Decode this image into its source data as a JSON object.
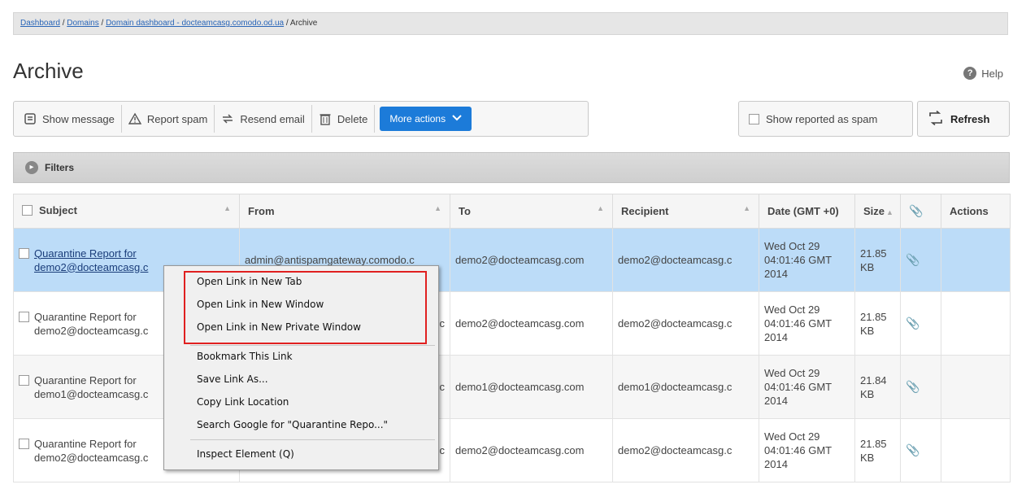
{
  "breadcrumb": {
    "items": [
      "Dashboard",
      "Domains",
      "Domain dashboard - docteamcasg.comodo.od.ua"
    ],
    "current": "Archive",
    "sep": " / "
  },
  "page": {
    "title": "Archive",
    "help_label": "Help"
  },
  "toolbar": {
    "show_message": "Show message",
    "report_spam": "Report spam",
    "resend_email": "Resend email",
    "delete": "Delete",
    "more_actions": "More actions",
    "show_reported_spam": "Show reported as spam",
    "refresh": "Refresh"
  },
  "filters": {
    "label": "Filters"
  },
  "table": {
    "headers": [
      "Subject",
      "From",
      "To",
      "Recipient",
      "Date (GMT +0)",
      "Size",
      "",
      "Actions"
    ],
    "rows": [
      {
        "subject_line1": "Quarantine Report for",
        "subject_line2": "demo2@docteamcasg.c",
        "from": "admin@antispamgateway.comodo.c",
        "to": "demo2@docteamcasg.com",
        "recipient": "demo2@docteamcasg.c",
        "date_line1": "Wed Oct 29",
        "date_line2": "04:01:46 GMT",
        "date_line3": "2014",
        "size_line1": "21.85",
        "size_line2": "KB"
      },
      {
        "subject_line1": "Quarantine Report for",
        "subject_line2": "demo2@docteamcasg.c",
        "from": ".c",
        "to": "demo2@docteamcasg.com",
        "recipient": "demo2@docteamcasg.c",
        "date_line1": "Wed Oct 29",
        "date_line2": "04:01:46 GMT",
        "date_line3": "2014",
        "size_line1": "21.85",
        "size_line2": "KB"
      },
      {
        "subject_line1": "Quarantine Report for",
        "subject_line2": "demo1@docteamcasg.c",
        "from": ".c",
        "to": "demo1@docteamcasg.com",
        "recipient": "demo1@docteamcasg.c",
        "date_line1": "Wed Oct 29",
        "date_line2": "04:01:46 GMT",
        "date_line3": "2014",
        "size_line1": "21.84",
        "size_line2": "KB"
      },
      {
        "subject_line1": "Quarantine Report for",
        "subject_line2": "demo2@docteamcasg.c",
        "from": ".c",
        "to": "demo2@docteamcasg.com",
        "recipient": "demo2@docteamcasg.c",
        "date_line1": "Wed Oct 29",
        "date_line2": "04:01:46 GMT",
        "date_line3": "2014",
        "size_line1": "21.85",
        "size_line2": "KB"
      }
    ]
  },
  "context_menu": {
    "items": [
      "Open Link in New Tab",
      "Open Link in New Window",
      "Open Link in New Private Window",
      "Bookmark This Link",
      "Save Link As...",
      "Copy Link Location",
      "Search Google for \"Quarantine Repo...\"",
      "Inspect Element (Q)"
    ]
  },
  "colors": {
    "accent": "#1c7bd9",
    "selected_row": "#bcdcf8",
    "highlight_border": "#e02020"
  }
}
